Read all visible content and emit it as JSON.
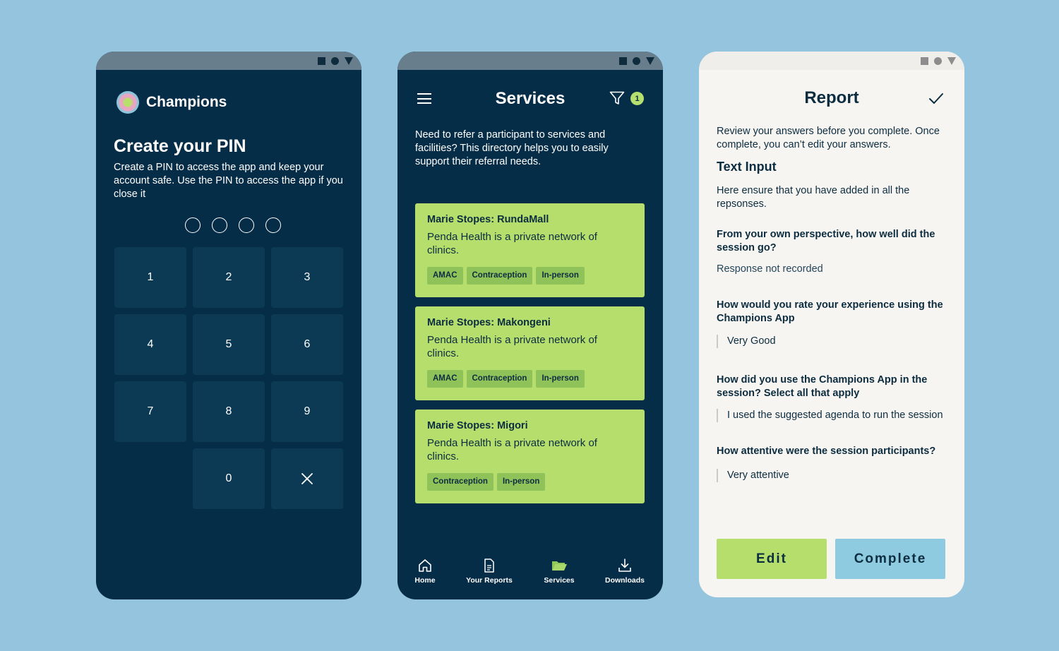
{
  "colors": {
    "background": "#94c4de",
    "dark_navy": "#062d47",
    "lime": "#b6de6d",
    "sky": "#8fcbe0",
    "cream": "#f7f5f2"
  },
  "pin_screen": {
    "app_name": "Champions",
    "title": "Create your PIN",
    "description": "Create a PIN to access the app and keep your account safe. Use the PIN to access the app if you close it",
    "pin_length": 4,
    "keys": [
      "1",
      "2",
      "3",
      "4",
      "5",
      "6",
      "7",
      "8",
      "9",
      "",
      "0",
      "delete-icon"
    ]
  },
  "services_screen": {
    "title": "Services",
    "filter_count": "1",
    "intro": "Need to refer a participant to services and facilities? This directory helps you to easily support their referral needs.",
    "cards": [
      {
        "title": "Marie Stopes: RundaMall",
        "description": "Penda Health is a private network of clinics.",
        "tags": [
          "AMAC",
          "Contraception",
          "In-person"
        ]
      },
      {
        "title": "Marie Stopes: Makongeni",
        "description": "Penda Health is a private network of clinics.",
        "tags": [
          "AMAC",
          "Contraception",
          "In-person"
        ]
      },
      {
        "title": "Marie Stopes: Migori",
        "description": "Penda Health is a private network of clinics.",
        "tags": [
          "Contraception",
          "In-person"
        ]
      }
    ],
    "nav": [
      {
        "label": "Home",
        "icon": "home-icon"
      },
      {
        "label": "Your Reports",
        "icon": "document-icon"
      },
      {
        "label": "Services",
        "icon": "folder-icon",
        "active": true
      },
      {
        "label": "Downloads",
        "icon": "download-icon"
      }
    ]
  },
  "report_screen": {
    "title": "Report",
    "review_text": "Review your answers before you complete. Once complete, you can’t edit your answers.",
    "section_title": "Text Input",
    "ensure_text": "Here ensure that you have added in all the repsonses.",
    "questions": [
      {
        "question": "From your own perspective, how well did the session go?",
        "answer": "Response not recorded"
      },
      {
        "question": "How would you rate your experience using the Champions App",
        "answer": "Very Good"
      },
      {
        "question": "How did you use the Champions App in the session? Select all that apply",
        "answer": "I used the suggested agenda to run the session"
      },
      {
        "question": "How attentive were the session participants?",
        "answer": "Very attentive"
      }
    ],
    "edit_label": "Edit",
    "complete_label": "Complete"
  }
}
